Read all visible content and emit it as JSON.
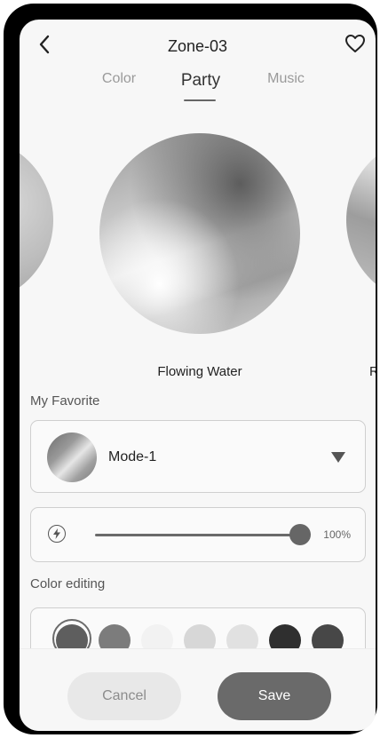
{
  "header": {
    "title": "Zone-03",
    "back_icon": "chevron-left-icon",
    "favorite_icon": "heart-icon"
  },
  "tabs": [
    {
      "label": "Color",
      "active": false
    },
    {
      "label": "Party",
      "active": true
    },
    {
      "label": "Music",
      "active": false
    }
  ],
  "carousel": {
    "current": "Flowing Water",
    "next_partial": "R"
  },
  "favorite": {
    "section_label": "My Favorite",
    "selected_mode": "Mode-1",
    "dropdown_icon": "triangle-down-icon"
  },
  "brightness": {
    "icon": "brightness-icon",
    "value": 100,
    "label": "100%"
  },
  "color_editing": {
    "section_label": "Color editing",
    "swatches": [
      "#5e5e5e",
      "#7c7c7c",
      "#f2f2f2",
      "#d7d7d7",
      "#e1e1e1",
      "#2f2f2f",
      "#474747"
    ],
    "selected_index": 0
  },
  "actions": {
    "cancel_label": "Cancel",
    "save_label": "Save"
  }
}
